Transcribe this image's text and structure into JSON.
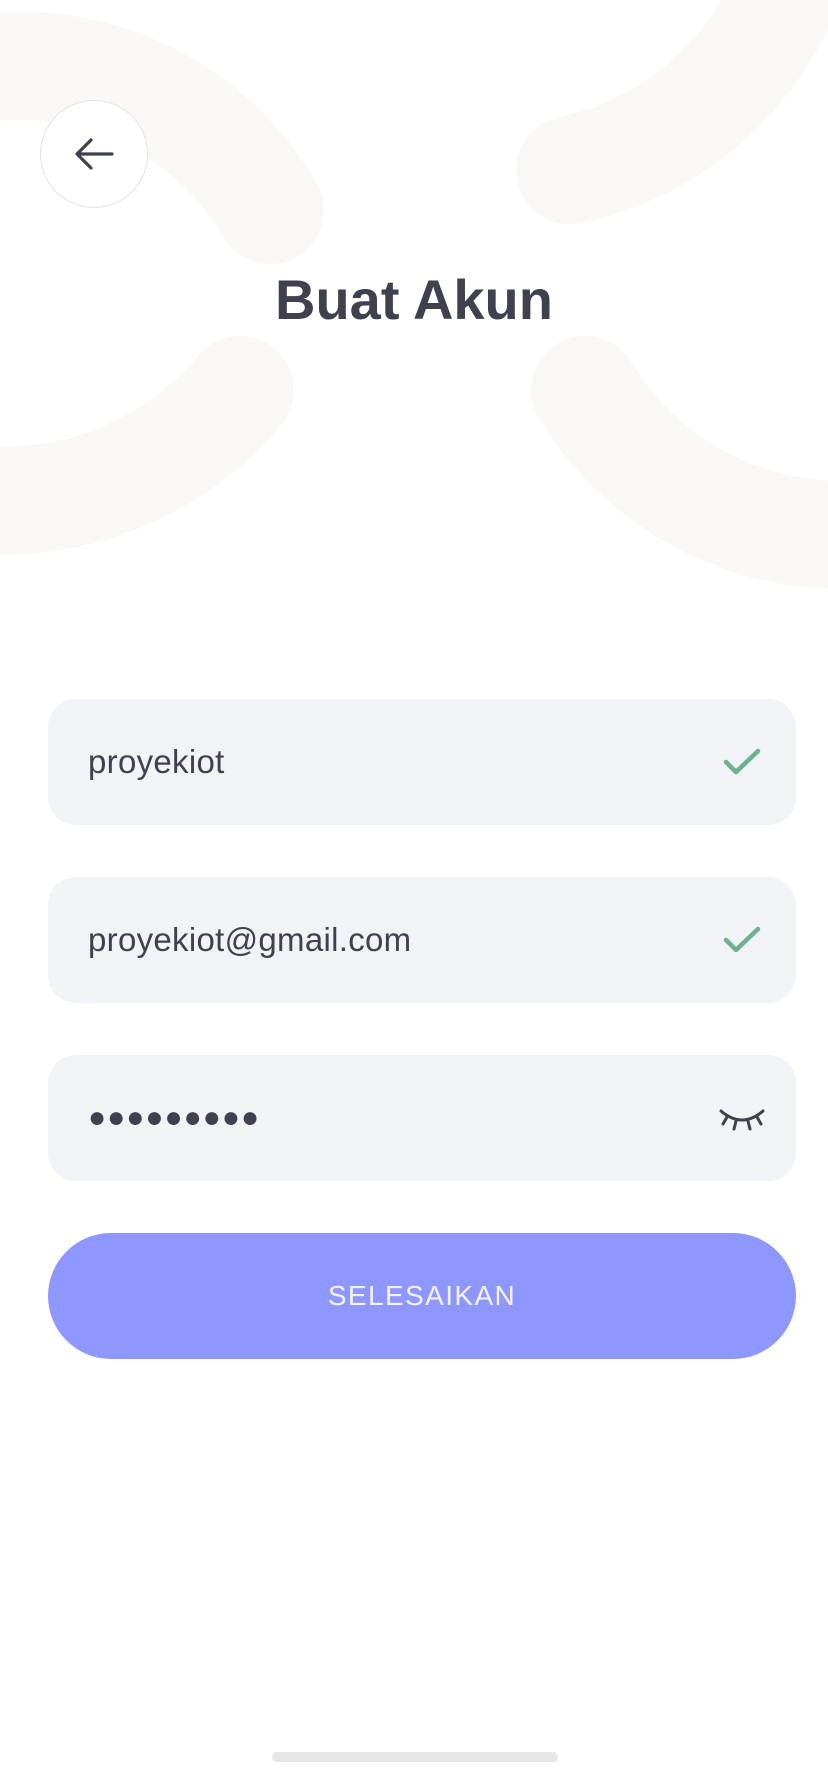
{
  "header": {
    "title": "Buat Akun",
    "back_icon": "arrow-left-icon"
  },
  "form": {
    "username": {
      "value": "proyekiot",
      "status_icon": "check-icon",
      "status_color": "#6cb28e"
    },
    "email": {
      "value": "proyekiot@gmail.com",
      "status_icon": "check-icon",
      "status_color": "#6cb28e"
    },
    "password": {
      "value": "●●●●●●●●●",
      "toggle_icon": "eye-closed-icon"
    },
    "submit_label": "SELESAIKAN"
  },
  "colors": {
    "accent": "#8e97fd",
    "text": "#3f414e",
    "field_bg": "#f2f3f7",
    "decoration": "#f9f8f6",
    "success": "#6cb28e"
  }
}
